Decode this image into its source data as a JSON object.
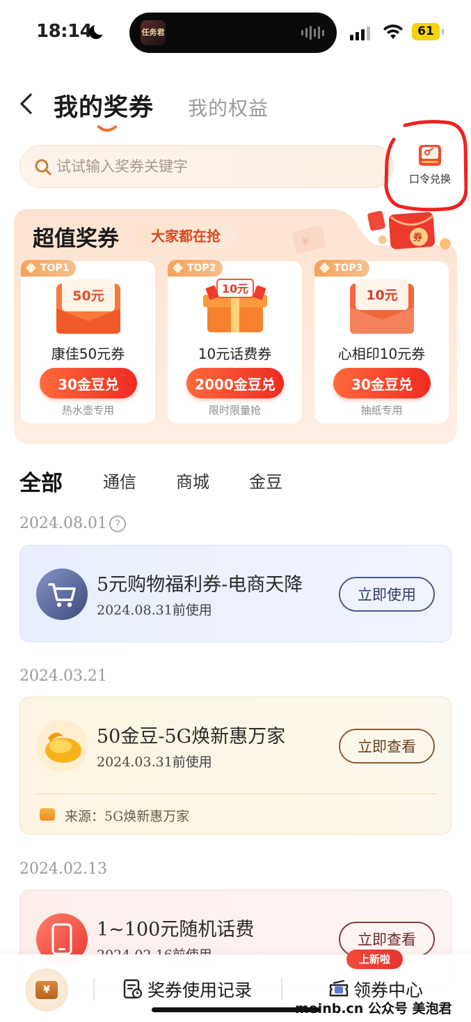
{
  "status_bar": {
    "time": "18:14",
    "battery": "61",
    "island_app": "任务君"
  },
  "header": {
    "tab_active": "我的奖券",
    "tab_inactive": "我的权益"
  },
  "search": {
    "placeholder": "试试输入奖券关键字"
  },
  "redeem": {
    "label": "口令兑换"
  },
  "super_coupons": {
    "title": "超值奖券",
    "badge": "大家都在抢",
    "items": [
      {
        "rank": "TOP1",
        "img_text": "50元",
        "name": "康佳50元券",
        "price": "30金豆兑",
        "note": "热水壶专用"
      },
      {
        "rank": "TOP2",
        "img_text": "10元",
        "name": "10元话费券",
        "price": "2000金豆兑",
        "note": "限时限量抢"
      },
      {
        "rank": "TOP3",
        "img_text": "10元",
        "name": "心相印10元券",
        "price": "30金豆兑",
        "note": "抽纸专用"
      }
    ]
  },
  "filters": [
    "全部",
    "通信",
    "商城",
    "金豆"
  ],
  "coupons": [
    {
      "date": "2024.08.01",
      "title": "5元购物福利券-电商天降",
      "expiry": "2024.08.31前使用",
      "action": "立即使用"
    },
    {
      "date": "2024.03.21",
      "title": "50金豆-5G焕新惠万家",
      "expiry": "2024.03.31前使用",
      "action": "立即查看",
      "source": "来源：5G焕新惠万家"
    },
    {
      "date": "2024.02.13",
      "title": "1~100元随机话费",
      "expiry": "2024.02.16前使用",
      "action": "立即查看"
    }
  ],
  "bottom_bar": {
    "wallet_symbol": "¥",
    "history": "奖券使用记录",
    "center": "领券中心",
    "new_badge": "上新啦"
  },
  "watermark": "meinb.cn  公众号 美泡君",
  "colors": {
    "accent": "#ee2b22",
    "annotation_circle": "#ee2222",
    "panel_bg": "#fde9da"
  }
}
